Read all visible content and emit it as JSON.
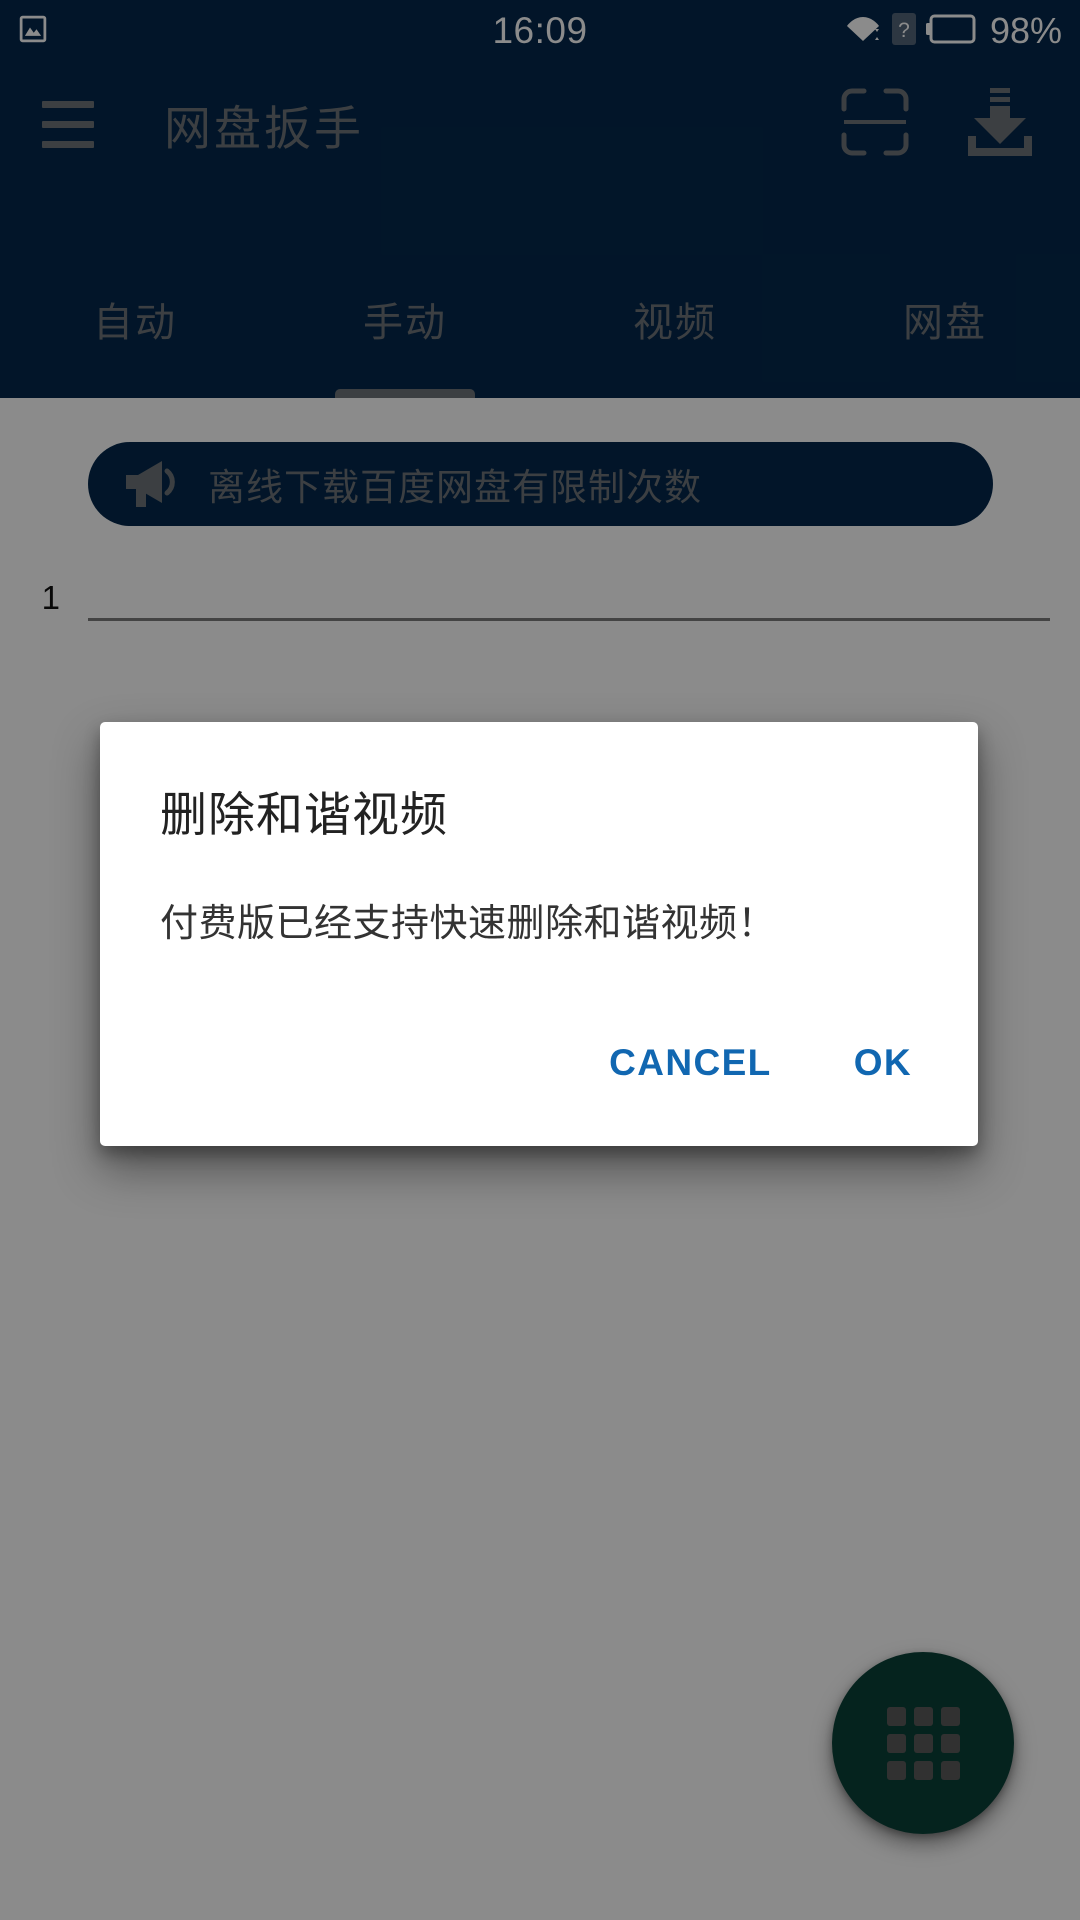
{
  "status_bar": {
    "time": "16:09",
    "battery_percent": "98%",
    "left_icons": [
      "screenshot-image-icon"
    ],
    "right_icons": [
      "wifi-icon",
      "sim-unknown-icon",
      "battery-icon"
    ],
    "background_color": "#04284b",
    "foreground_color": "#ffffff"
  },
  "app_bar": {
    "title": "网盘扳手",
    "menu_label": "菜单",
    "actions": [
      {
        "name": "scan-qr-button",
        "label": "扫码"
      },
      {
        "name": "download-button",
        "label": "下载"
      }
    ],
    "background_color": "#04284b",
    "text_color": "#6f7579"
  },
  "tabs": {
    "selected_index": 1,
    "items": [
      {
        "label": "自动"
      },
      {
        "label": "手动"
      },
      {
        "label": "视频"
      },
      {
        "label": "网盘"
      }
    ]
  },
  "content": {
    "notice": {
      "text": "离线下载百度网盘有限制次数",
      "icon": "megaphone-icon",
      "background_color": "#04284b"
    },
    "editor": {
      "line_number": "1",
      "value": "",
      "placeholder": ""
    },
    "fab": {
      "icon": "grid-3x3-icon",
      "color": "#0a4037"
    }
  },
  "dialog": {
    "title": "删除和谐视频",
    "message": "付费版已经支持快速删除和谐视频！",
    "cancel_label": "CANCEL",
    "ok_label": "OK",
    "button_color": "#1167b1",
    "background_color": "#ffffff"
  },
  "scrim": {
    "color": "#646464"
  }
}
